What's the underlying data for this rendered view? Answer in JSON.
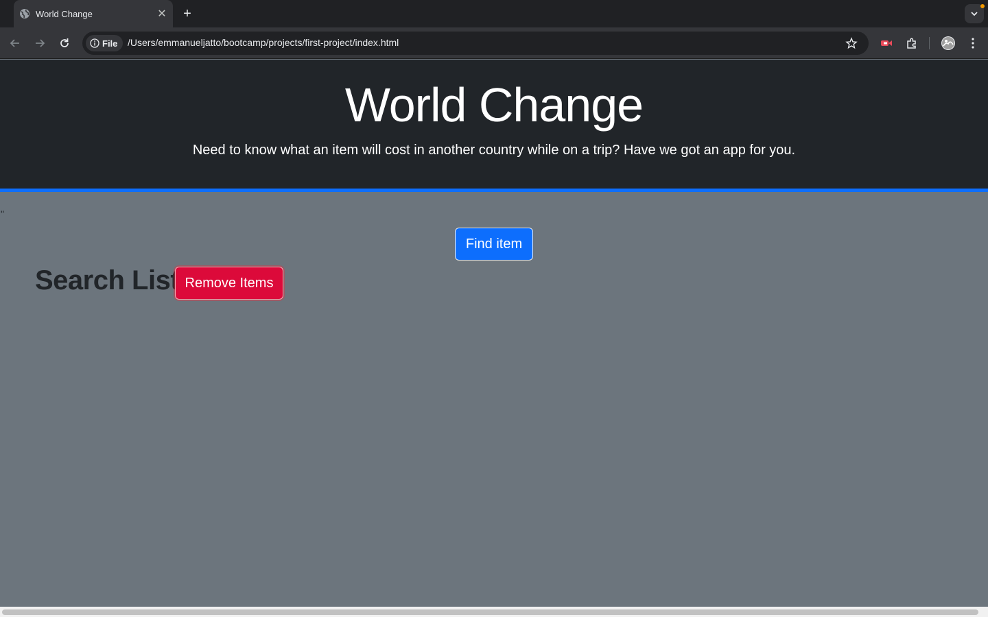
{
  "browser": {
    "tab_title": "World Change",
    "address_chip": "File",
    "url": "/Users/emmanueljatto/bootcamp/projects/first-project/index.html",
    "icons": [
      "globe-icon",
      "close-icon",
      "plus-icon",
      "back-icon",
      "forward-icon",
      "reload-icon",
      "info-icon",
      "star-icon",
      "recorder-extension-icon",
      "extensions-icon",
      "profile-avatar",
      "more-icon",
      "chevron-down-icon"
    ]
  },
  "hero": {
    "title": "World Change",
    "subtitle": "Need to know what an item will cost in another country while on a trip? Have we got an app for you."
  },
  "main": {
    "stray_text": "\"",
    "find_button": "Find item",
    "search_list_heading": "Search List",
    "remove_button": "Remove Items"
  },
  "colors": {
    "hero_bg": "#212529",
    "page_bg": "#6c757d",
    "accent_blue": "#0d6efd",
    "danger_red": "#dc0a3a"
  }
}
